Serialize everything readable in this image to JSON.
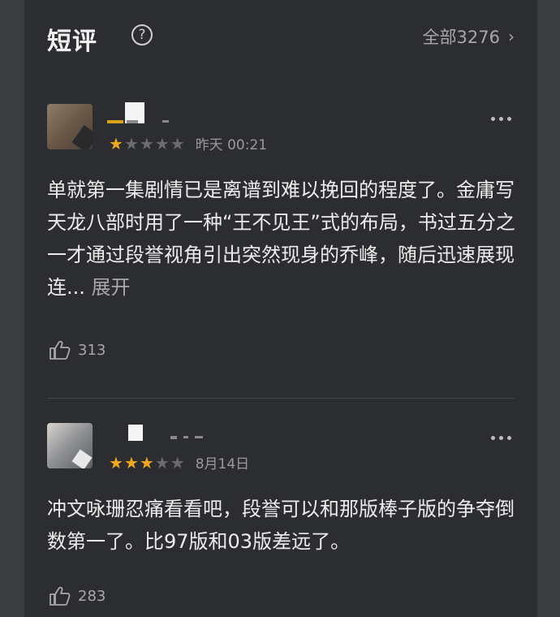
{
  "header": {
    "title": "短评",
    "help_icon": "?",
    "all_label": "全部3276",
    "chevron": "›"
  },
  "reviews": [
    {
      "rating": 1,
      "rating_max": 5,
      "time": "昨天 00:21",
      "text": "单就第一集剧情已是离谱到难以挽回的程度了。金庸写天龙八部时用了一种“王不见王”式的布局，书过五分之一才通过段誉视角引出突然现身的乔峰，随后迅速展现连...",
      "expand_label": "展开",
      "likes": "313"
    },
    {
      "rating": 3,
      "rating_max": 5,
      "time": "8月14日",
      "text": "冲文咏珊忍痛看看吧，段誉可以和那版棒子版的争夺倒数第一了。比97版和03版差远了。",
      "likes": "283"
    }
  ],
  "colors": {
    "background": "#2c2d31",
    "star_on": "#f2a81d",
    "star_off": "#6b6c70",
    "muted_text": "#a8a8a8"
  },
  "icons": [
    "help-icon",
    "chevron-right-icon",
    "more-icon",
    "thumbs-up-icon",
    "star-icon"
  ]
}
